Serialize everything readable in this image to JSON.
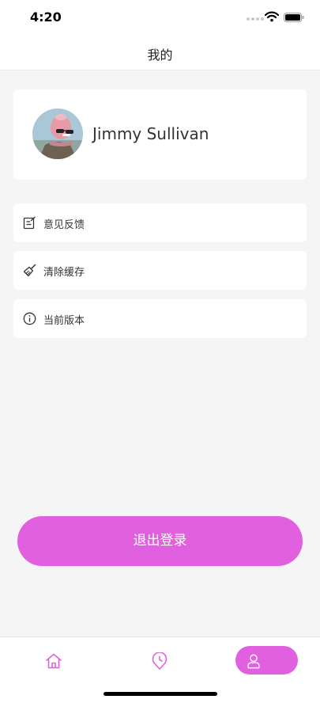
{
  "status_bar": {
    "time": "4:20"
  },
  "nav": {
    "title": "我的"
  },
  "profile": {
    "name": "Jimmy Sullivan"
  },
  "menu": [
    {
      "label": "意见反馈",
      "icon": "edit-note-icon"
    },
    {
      "label": "清除缓存",
      "icon": "broom-icon"
    },
    {
      "label": "当前版本",
      "icon": "info-icon"
    }
  ],
  "logout": {
    "label": "退出登录"
  },
  "tab_bar": {
    "tabs": [
      {
        "icon": "home-icon",
        "active": false
      },
      {
        "icon": "clock-pin-icon",
        "active": false
      },
      {
        "icon": "user-icon",
        "active": true
      }
    ]
  },
  "colors": {
    "accent": "#e060e0",
    "background": "#f5f5f5",
    "card": "#ffffff"
  }
}
